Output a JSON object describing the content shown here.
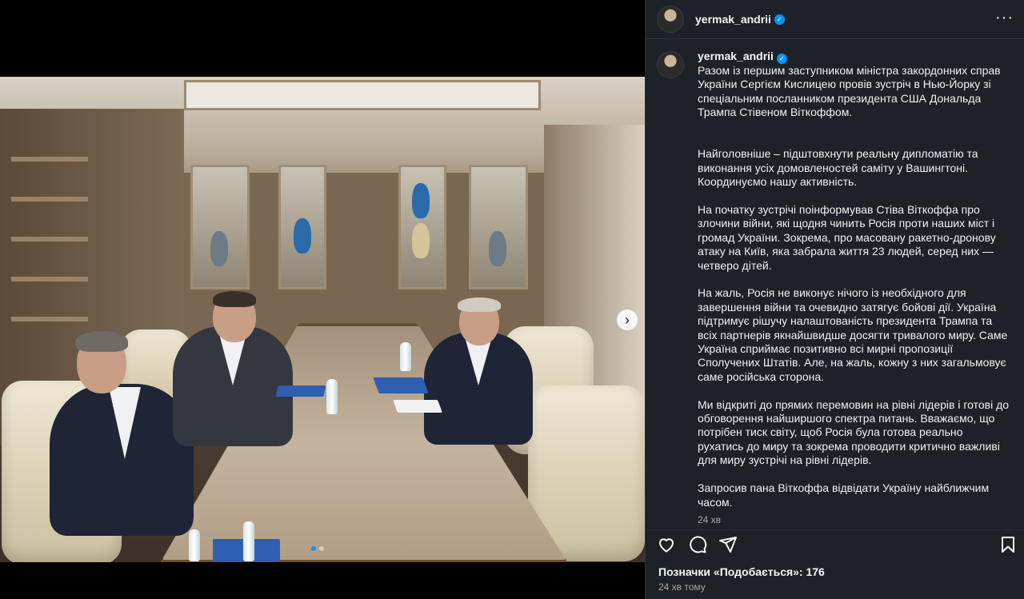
{
  "post": {
    "author": "yermak_andrii",
    "verified_icon": "verified-badge-icon",
    "more_label": "···",
    "caption_paragraphs": [
      "Разом із першим заступником міністра закордонних справ України Сергієм Кислицею провів зустріч в Нью-Йорку зі спеціальним посланником президента США Дональда Трампа Стівеном Віткоффом.",
      "Найголовніше – підштовхнути реальну дипломатію та виконання усіх домовленостей саміту у Вашингтоні. Координуємо нашу активність.",
      "На початку зустрічі поінформував Стіва Віткоффа про злочини війни, які щодня чинить Росія проти наших міст і громад України. Зокрема, про масовану ракетно-дронову атаку на Київ, яка забрала життя 23 людей, серед них — четверо дітей.",
      "На жаль, Росія не виконує нічого із необхідного для завершення війни та очевидно затягує бойові дії. Україна підтримує рішучу налаштованість президента Трампа та всіх партнерів якнайшвидше досягти тривалого миру. Саме Україна сприймає позитивно всі мирні пропозиції Сполучених Штатів. Але, на жаль, кожну з них загальмовує саме російська сторона.",
      "Ми відкриті до прямих перемовин на рівні лідерів і готові до обговорення найширшого спектра питань. Вважаємо, що потрібен тиск світу, щоб Росія була готова реально рухатись до миру та зокрема проводити критично важливі для миру зустрічі на рівні лідерів.",
      "Запросив пана Віткоффа відвідати Україну найближчим часом."
    ],
    "caption_time": "24 хв",
    "likes_text": "Позначки «Подобається»: 176",
    "posted_time": "24 хв тому"
  },
  "media": {
    "carousel_count": 2,
    "carousel_active": 0,
    "next_icon": "chevron-right-icon"
  },
  "icons": {
    "like": "heart-icon",
    "comment": "comment-icon",
    "share": "send-icon",
    "save": "bookmark-icon"
  },
  "colors": {
    "accent": "#0095f6",
    "panel_bg": "#1f2129",
    "muted_text": "#a8a8a8"
  }
}
